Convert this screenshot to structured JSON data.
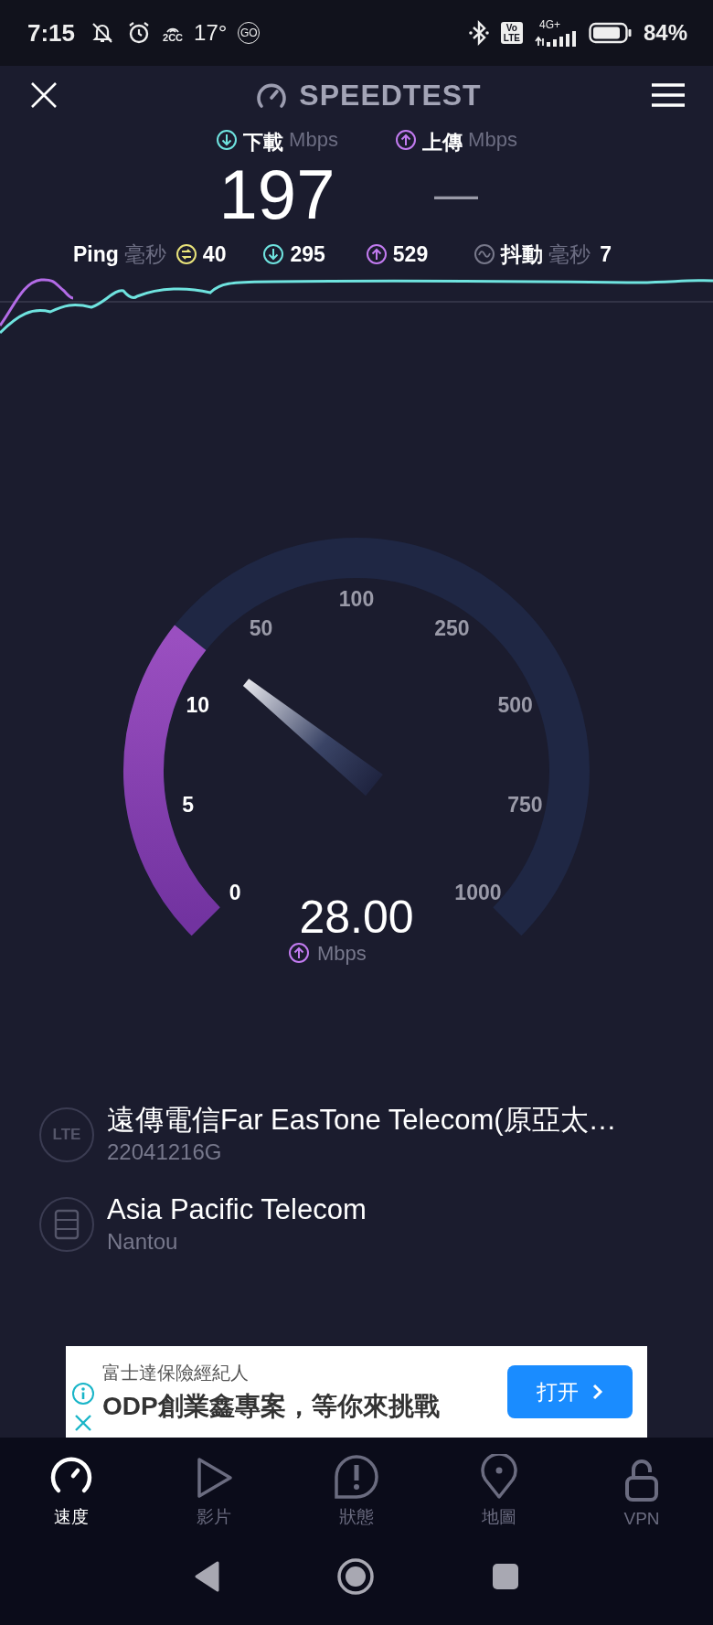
{
  "status_bar": {
    "time": "7:15",
    "hotspot_label": "2CC",
    "temperature": "17°",
    "go_badge": "GO",
    "volte_badge": [
      "Vo",
      "LTE"
    ],
    "network_type": "4G+",
    "battery": "84%"
  },
  "header": {
    "title": "SPEEDTEST"
  },
  "results": {
    "download": {
      "label": "下載",
      "unit": "Mbps",
      "value": "197"
    },
    "upload": {
      "label": "上傳",
      "unit": "Mbps",
      "value": "—"
    }
  },
  "metrics": {
    "ping": {
      "label": "Ping",
      "unit": "毫秒",
      "value": "40"
    },
    "download_ping": {
      "value": "295"
    },
    "upload_ping": {
      "value": "529"
    },
    "jitter": {
      "label": "抖動",
      "unit": "毫秒",
      "value": "7"
    }
  },
  "gauge": {
    "ticks": [
      "0",
      "5",
      "10",
      "50",
      "100",
      "250",
      "500",
      "750",
      "1000"
    ],
    "reading": "28.00",
    "unit": "Mbps"
  },
  "servers": [
    {
      "kind": "lte",
      "icon_text": "LTE",
      "name": "遠傳電信Far EasTone Telecom(原亞太…",
      "detail": "22041216G"
    },
    {
      "kind": "server",
      "name": "Asia Pacific Telecom",
      "detail": "Nantou"
    }
  ],
  "ad": {
    "advertiser": "富士達保險經紀人",
    "headline": "ODP創業鑫專案，等你來挑戰",
    "button": "打开"
  },
  "nav": [
    {
      "kind": "speed",
      "label": "速度",
      "selected": true
    },
    {
      "kind": "video",
      "label": "影片",
      "selected": false
    },
    {
      "kind": "status",
      "label": "狀態",
      "selected": false
    },
    {
      "kind": "map",
      "label": "地圖",
      "selected": false
    },
    {
      "kind": "vpn",
      "label": "VPN",
      "selected": false
    }
  ]
}
